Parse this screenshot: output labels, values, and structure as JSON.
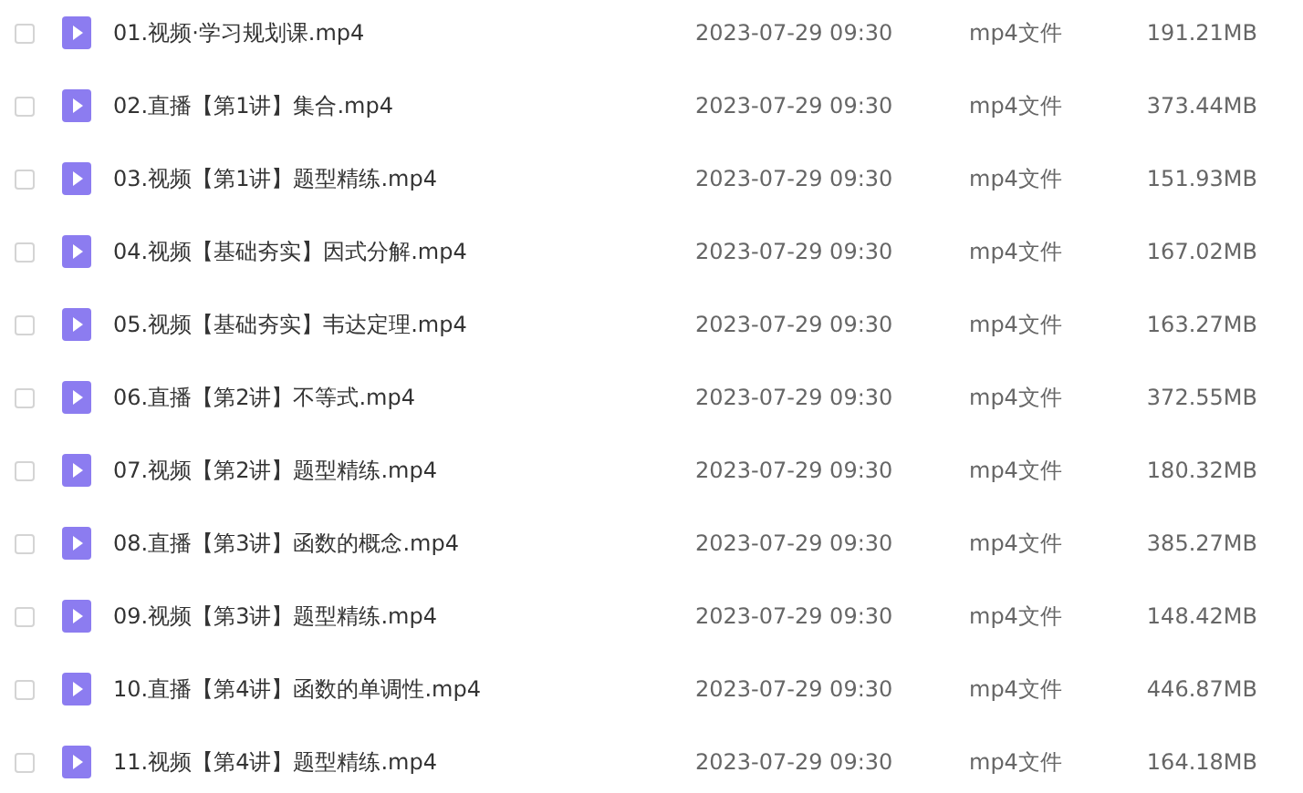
{
  "files": [
    {
      "name": "01.视频·学习规划课.mp4",
      "checked": false,
      "modified": "2023-07-29 09:30",
      "type": "mp4文件",
      "size": "191.21MB"
    },
    {
      "name": "02.直播【第1讲】集合.mp4",
      "checked": false,
      "modified": "2023-07-29 09:30",
      "type": "mp4文件",
      "size": "373.44MB"
    },
    {
      "name": "03.视频【第1讲】题型精练.mp4",
      "checked": false,
      "modified": "2023-07-29 09:30",
      "type": "mp4文件",
      "size": "151.93MB"
    },
    {
      "name": "04.视频【基础夯实】因式分解.mp4",
      "checked": false,
      "modified": "2023-07-29 09:30",
      "type": "mp4文件",
      "size": "167.02MB"
    },
    {
      "name": "05.视频【基础夯实】韦达定理.mp4",
      "checked": false,
      "modified": "2023-07-29 09:30",
      "type": "mp4文件",
      "size": "163.27MB"
    },
    {
      "name": "06.直播【第2讲】不等式.mp4",
      "checked": false,
      "modified": "2023-07-29 09:30",
      "type": "mp4文件",
      "size": "372.55MB"
    },
    {
      "name": "07.视频【第2讲】题型精练.mp4",
      "checked": false,
      "modified": "2023-07-29 09:30",
      "type": "mp4文件",
      "size": "180.32MB"
    },
    {
      "name": "08.直播【第3讲】函数的概念.mp4",
      "checked": false,
      "modified": "2023-07-29 09:30",
      "type": "mp4文件",
      "size": "385.27MB"
    },
    {
      "name": "09.视频【第3讲】题型精练.mp4",
      "checked": false,
      "modified": "2023-07-29 09:30",
      "type": "mp4文件",
      "size": "148.42MB"
    },
    {
      "name": "10.直播【第4讲】函数的单调性.mp4",
      "checked": false,
      "modified": "2023-07-29 09:30",
      "type": "mp4文件",
      "size": "446.87MB"
    },
    {
      "name": "11.视频【第4讲】题型精练.mp4",
      "checked": false,
      "modified": "2023-07-29 09:30",
      "type": "mp4文件",
      "size": "164.18MB"
    }
  ]
}
